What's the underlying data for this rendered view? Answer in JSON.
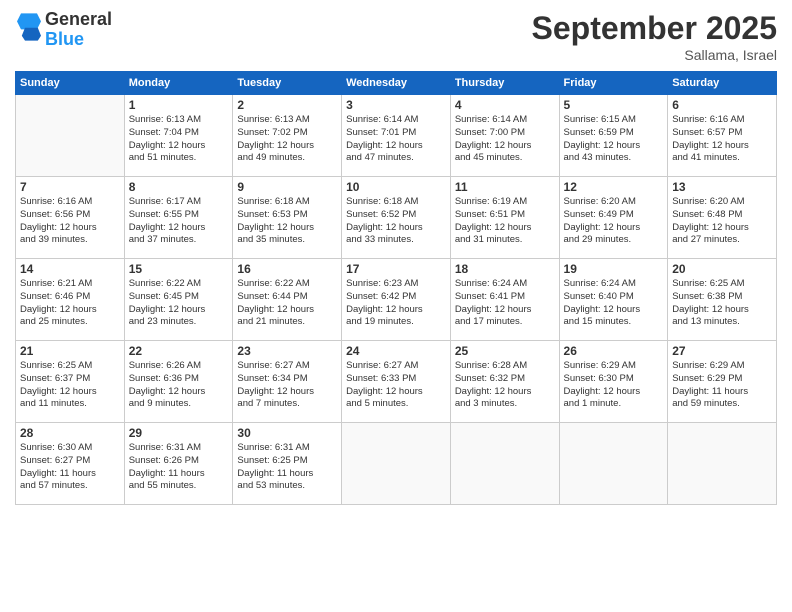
{
  "logo": {
    "general": "General",
    "blue": "Blue"
  },
  "header": {
    "month": "September 2025",
    "location": "Sallama, Israel"
  },
  "weekdays": [
    "Sunday",
    "Monday",
    "Tuesday",
    "Wednesday",
    "Thursday",
    "Friday",
    "Saturday"
  ],
  "weeks": [
    [
      {
        "day": "",
        "info": ""
      },
      {
        "day": "1",
        "info": "Sunrise: 6:13 AM\nSunset: 7:04 PM\nDaylight: 12 hours\nand 51 minutes."
      },
      {
        "day": "2",
        "info": "Sunrise: 6:13 AM\nSunset: 7:02 PM\nDaylight: 12 hours\nand 49 minutes."
      },
      {
        "day": "3",
        "info": "Sunrise: 6:14 AM\nSunset: 7:01 PM\nDaylight: 12 hours\nand 47 minutes."
      },
      {
        "day": "4",
        "info": "Sunrise: 6:14 AM\nSunset: 7:00 PM\nDaylight: 12 hours\nand 45 minutes."
      },
      {
        "day": "5",
        "info": "Sunrise: 6:15 AM\nSunset: 6:59 PM\nDaylight: 12 hours\nand 43 minutes."
      },
      {
        "day": "6",
        "info": "Sunrise: 6:16 AM\nSunset: 6:57 PM\nDaylight: 12 hours\nand 41 minutes."
      }
    ],
    [
      {
        "day": "7",
        "info": "Sunrise: 6:16 AM\nSunset: 6:56 PM\nDaylight: 12 hours\nand 39 minutes."
      },
      {
        "day": "8",
        "info": "Sunrise: 6:17 AM\nSunset: 6:55 PM\nDaylight: 12 hours\nand 37 minutes."
      },
      {
        "day": "9",
        "info": "Sunrise: 6:18 AM\nSunset: 6:53 PM\nDaylight: 12 hours\nand 35 minutes."
      },
      {
        "day": "10",
        "info": "Sunrise: 6:18 AM\nSunset: 6:52 PM\nDaylight: 12 hours\nand 33 minutes."
      },
      {
        "day": "11",
        "info": "Sunrise: 6:19 AM\nSunset: 6:51 PM\nDaylight: 12 hours\nand 31 minutes."
      },
      {
        "day": "12",
        "info": "Sunrise: 6:20 AM\nSunset: 6:49 PM\nDaylight: 12 hours\nand 29 minutes."
      },
      {
        "day": "13",
        "info": "Sunrise: 6:20 AM\nSunset: 6:48 PM\nDaylight: 12 hours\nand 27 minutes."
      }
    ],
    [
      {
        "day": "14",
        "info": "Sunrise: 6:21 AM\nSunset: 6:46 PM\nDaylight: 12 hours\nand 25 minutes."
      },
      {
        "day": "15",
        "info": "Sunrise: 6:22 AM\nSunset: 6:45 PM\nDaylight: 12 hours\nand 23 minutes."
      },
      {
        "day": "16",
        "info": "Sunrise: 6:22 AM\nSunset: 6:44 PM\nDaylight: 12 hours\nand 21 minutes."
      },
      {
        "day": "17",
        "info": "Sunrise: 6:23 AM\nSunset: 6:42 PM\nDaylight: 12 hours\nand 19 minutes."
      },
      {
        "day": "18",
        "info": "Sunrise: 6:24 AM\nSunset: 6:41 PM\nDaylight: 12 hours\nand 17 minutes."
      },
      {
        "day": "19",
        "info": "Sunrise: 6:24 AM\nSunset: 6:40 PM\nDaylight: 12 hours\nand 15 minutes."
      },
      {
        "day": "20",
        "info": "Sunrise: 6:25 AM\nSunset: 6:38 PM\nDaylight: 12 hours\nand 13 minutes."
      }
    ],
    [
      {
        "day": "21",
        "info": "Sunrise: 6:25 AM\nSunset: 6:37 PM\nDaylight: 12 hours\nand 11 minutes."
      },
      {
        "day": "22",
        "info": "Sunrise: 6:26 AM\nSunset: 6:36 PM\nDaylight: 12 hours\nand 9 minutes."
      },
      {
        "day": "23",
        "info": "Sunrise: 6:27 AM\nSunset: 6:34 PM\nDaylight: 12 hours\nand 7 minutes."
      },
      {
        "day": "24",
        "info": "Sunrise: 6:27 AM\nSunset: 6:33 PM\nDaylight: 12 hours\nand 5 minutes."
      },
      {
        "day": "25",
        "info": "Sunrise: 6:28 AM\nSunset: 6:32 PM\nDaylight: 12 hours\nand 3 minutes."
      },
      {
        "day": "26",
        "info": "Sunrise: 6:29 AM\nSunset: 6:30 PM\nDaylight: 12 hours\nand 1 minute."
      },
      {
        "day": "27",
        "info": "Sunrise: 6:29 AM\nSunset: 6:29 PM\nDaylight: 11 hours\nand 59 minutes."
      }
    ],
    [
      {
        "day": "28",
        "info": "Sunrise: 6:30 AM\nSunset: 6:27 PM\nDaylight: 11 hours\nand 57 minutes."
      },
      {
        "day": "29",
        "info": "Sunrise: 6:31 AM\nSunset: 6:26 PM\nDaylight: 11 hours\nand 55 minutes."
      },
      {
        "day": "30",
        "info": "Sunrise: 6:31 AM\nSunset: 6:25 PM\nDaylight: 11 hours\nand 53 minutes."
      },
      {
        "day": "",
        "info": ""
      },
      {
        "day": "",
        "info": ""
      },
      {
        "day": "",
        "info": ""
      },
      {
        "day": "",
        "info": ""
      }
    ]
  ]
}
